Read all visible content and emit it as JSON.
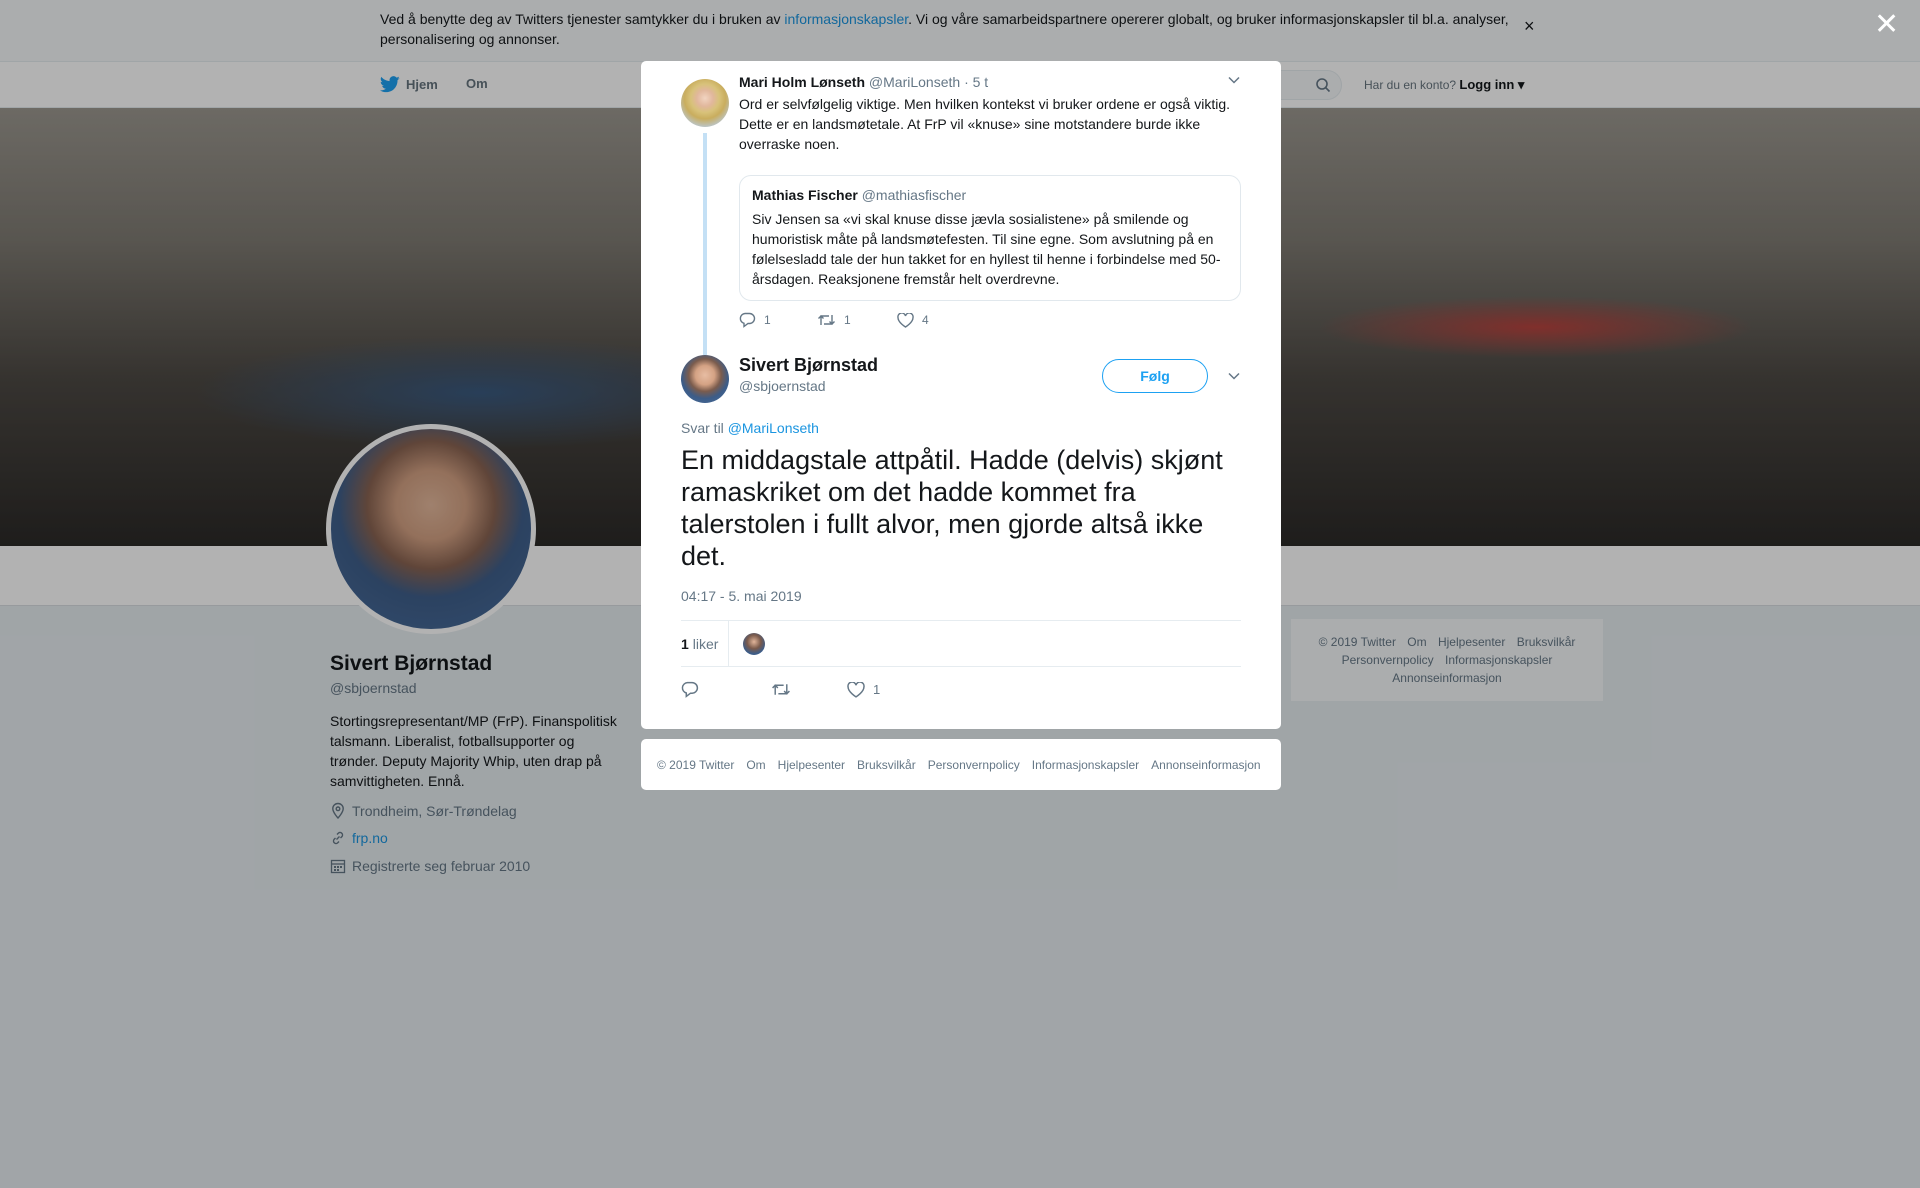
{
  "cookie": {
    "text_before": "Ved å benytte deg av Twitters tjenester samtykker du i bruken av ",
    "link": "informasjonskapsler",
    "text_after": ". Vi og våre samarbeidspartnere opererer globalt, og bruker informasjonskapsler til bl.a. analyser, personalisering og annonser.",
    "close": "×"
  },
  "nav": {
    "home": "Hjem",
    "about": "Om",
    "account_question": "Har du en konto?",
    "login": "Logg inn"
  },
  "profile": {
    "name": "Sivert Bjørnstad",
    "handle": "@sbjoernstad",
    "bio": "Stortingsrepresentant/MP (FrP). Finanspolitisk talsmann. Liberalist, fotballsupporter og trønder. Deputy Majority Whip, uten drap på samvittigheten. Ennå.",
    "location": "Trondheim, Sør-Trøndelag",
    "website": "frp.no",
    "joined": "Registrerte seg februar 2010"
  },
  "side_footer": {
    "items": [
      "© 2019 Twitter",
      "Om",
      "Hjelpesenter",
      "Bruksvilkår",
      "Personvernpolicy",
      "Informasjonskapsler",
      "Annonseinformasjon"
    ]
  },
  "overlay": {
    "close": "✕"
  },
  "parent_tweet": {
    "name": "Mari Holm Lønseth",
    "handle": "@MariLonseth",
    "time": "· 5 t",
    "text": "Ord er selvfølgelig viktige. Men hvilken kontekst vi bruker ordene er også viktig. Dette er en landsmøtetale. At FrP vil «knuse» sine motstandere burde ikke overraske noen.",
    "quote": {
      "name": "Mathias Fischer",
      "handle": "@mathiasfischer",
      "text": "Siv Jensen sa «vi skal knuse disse jævla sosialistene» på smilende og humoristisk måte på landsmøtefesten. Til sine egne. Som avslutning på en følelsesladd tale der hun takket for en hyllest til henne i forbindelse med 50-årsdagen. Reaksjonene fremstår helt overdrevne."
    },
    "replies": "1",
    "retweets": "1",
    "likes": "4"
  },
  "main_tweet": {
    "name": "Sivert Bjørnstad",
    "handle": "@sbjoernstad",
    "follow": "Følg",
    "reply_prefix": "Svar til",
    "reply_target": "@MariLonseth",
    "text": "En middagstale attpåtil. Hadde (delvis) skjønt ramaskriket om det hadde kommet fra talerstolen i fullt alvor, men gjorde altså ikke det.",
    "date": "04:17 - 5. mai 2019",
    "likes_count": "1",
    "likes_label": "liker",
    "like_count_action": "1"
  },
  "modal_footer": {
    "items": [
      "© 2019 Twitter",
      "Om",
      "Hjelpesenter",
      "Bruksvilkår",
      "Personvernpolicy",
      "Informasjonskapsler",
      "Annonseinformasjon"
    ]
  },
  "colors": {
    "twitter_blue": "#1da1f2",
    "link_blue": "#1b95e0",
    "muted_text": "#657786"
  }
}
